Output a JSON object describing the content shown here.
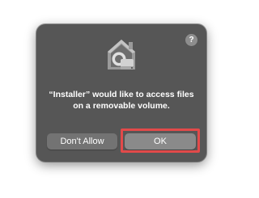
{
  "dialog": {
    "icon": "installer-home-drive-icon",
    "help_label": "?",
    "message": "“Installer” would like to access files on a removable volume.",
    "buttons": {
      "deny_label": "Don't Allow",
      "ok_label": "OK"
    }
  },
  "annotation": {
    "color": "#e24a4a",
    "target": "ok-button"
  },
  "colors": {
    "dialog_background": "#565656",
    "button_background": "#737373",
    "ok_button_background": "#8a8a8a",
    "text": "#ffffff"
  }
}
